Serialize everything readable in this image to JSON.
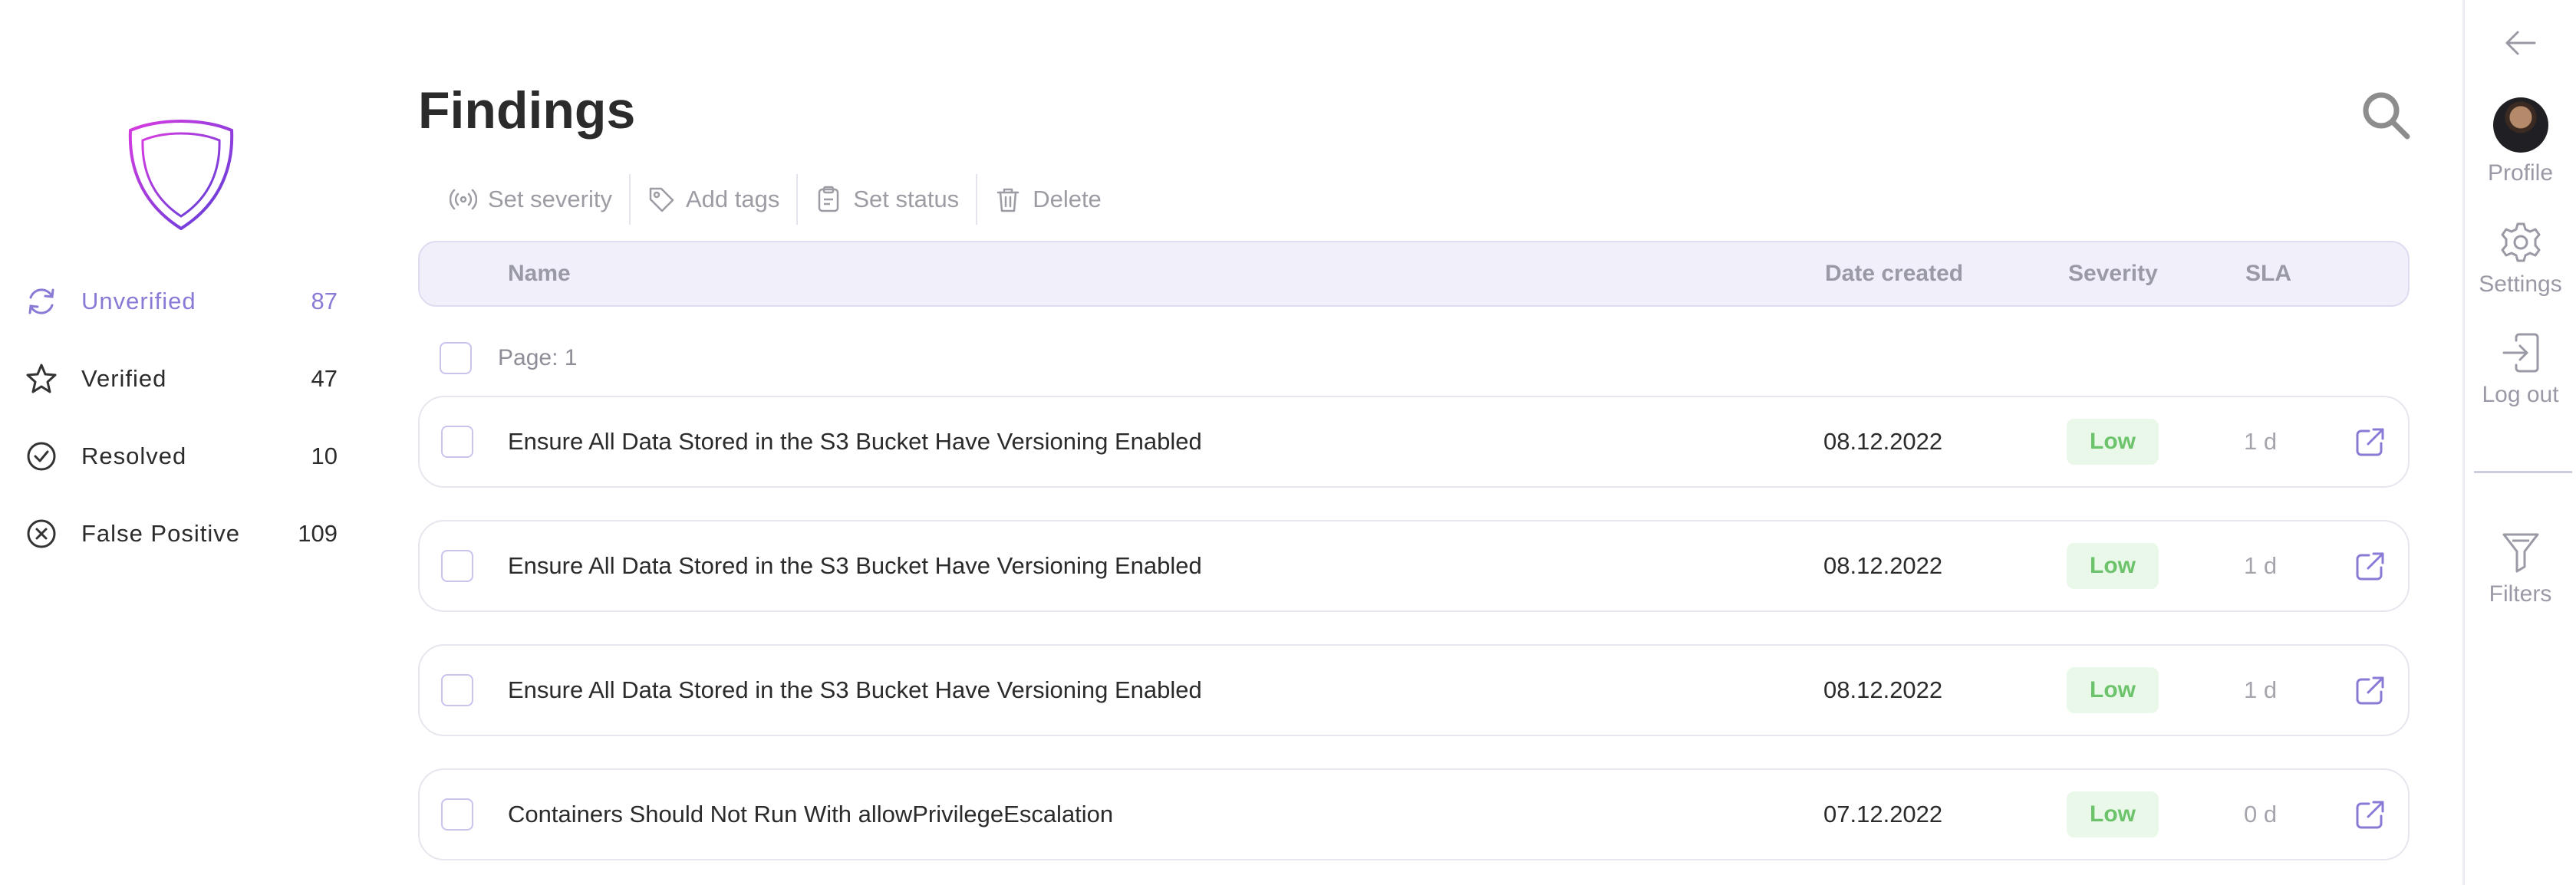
{
  "sidebar": {
    "logo_icon": "shield-icon",
    "items": [
      {
        "label": "Unverified",
        "count": "87",
        "icon": "sync-icon",
        "active": true
      },
      {
        "label": "Verified",
        "count": "47",
        "icon": "star-icon",
        "active": false
      },
      {
        "label": "Resolved",
        "count": "10",
        "icon": "check-circle-icon",
        "active": false
      },
      {
        "label": "False Positive",
        "count": "109",
        "icon": "x-circle-icon",
        "active": false
      }
    ]
  },
  "header": {
    "title": "Findings",
    "search_icon": "search-icon"
  },
  "toolbar": {
    "set_severity": "Set severity",
    "add_tags": "Add tags",
    "set_status": "Set status",
    "delete": "Delete"
  },
  "table": {
    "columns": {
      "name": "Name",
      "date": "Date created",
      "severity": "Severity",
      "sla": "SLA"
    },
    "page_label": "Page: 1",
    "rows": [
      {
        "name": "Ensure All Data Stored in the S3 Bucket Have Versioning Enabled",
        "date": "08.12.2022",
        "severity": "Low",
        "sla": "1 d"
      },
      {
        "name": "Ensure All Data Stored in the S3 Bucket Have Versioning Enabled",
        "date": "08.12.2022",
        "severity": "Low",
        "sla": "1 d"
      },
      {
        "name": "Ensure All Data Stored in the S3 Bucket Have Versioning Enabled",
        "date": "08.12.2022",
        "severity": "Low",
        "sla": "1 d"
      },
      {
        "name": "Containers Should Not Run With allowPrivilegeEscalation",
        "date": "07.12.2022",
        "severity": "Low",
        "sla": "0 d"
      }
    ]
  },
  "rail": {
    "back_icon": "arrow-left-icon",
    "profile": "Profile",
    "settings": "Settings",
    "logout": "Log out",
    "filters": "Filters"
  },
  "colors": {
    "accent": "#8a7ad6",
    "severity_low_bg": "#e9f8e9",
    "severity_low_text": "#6cc36c",
    "header_bg": "#f1f0fa"
  }
}
